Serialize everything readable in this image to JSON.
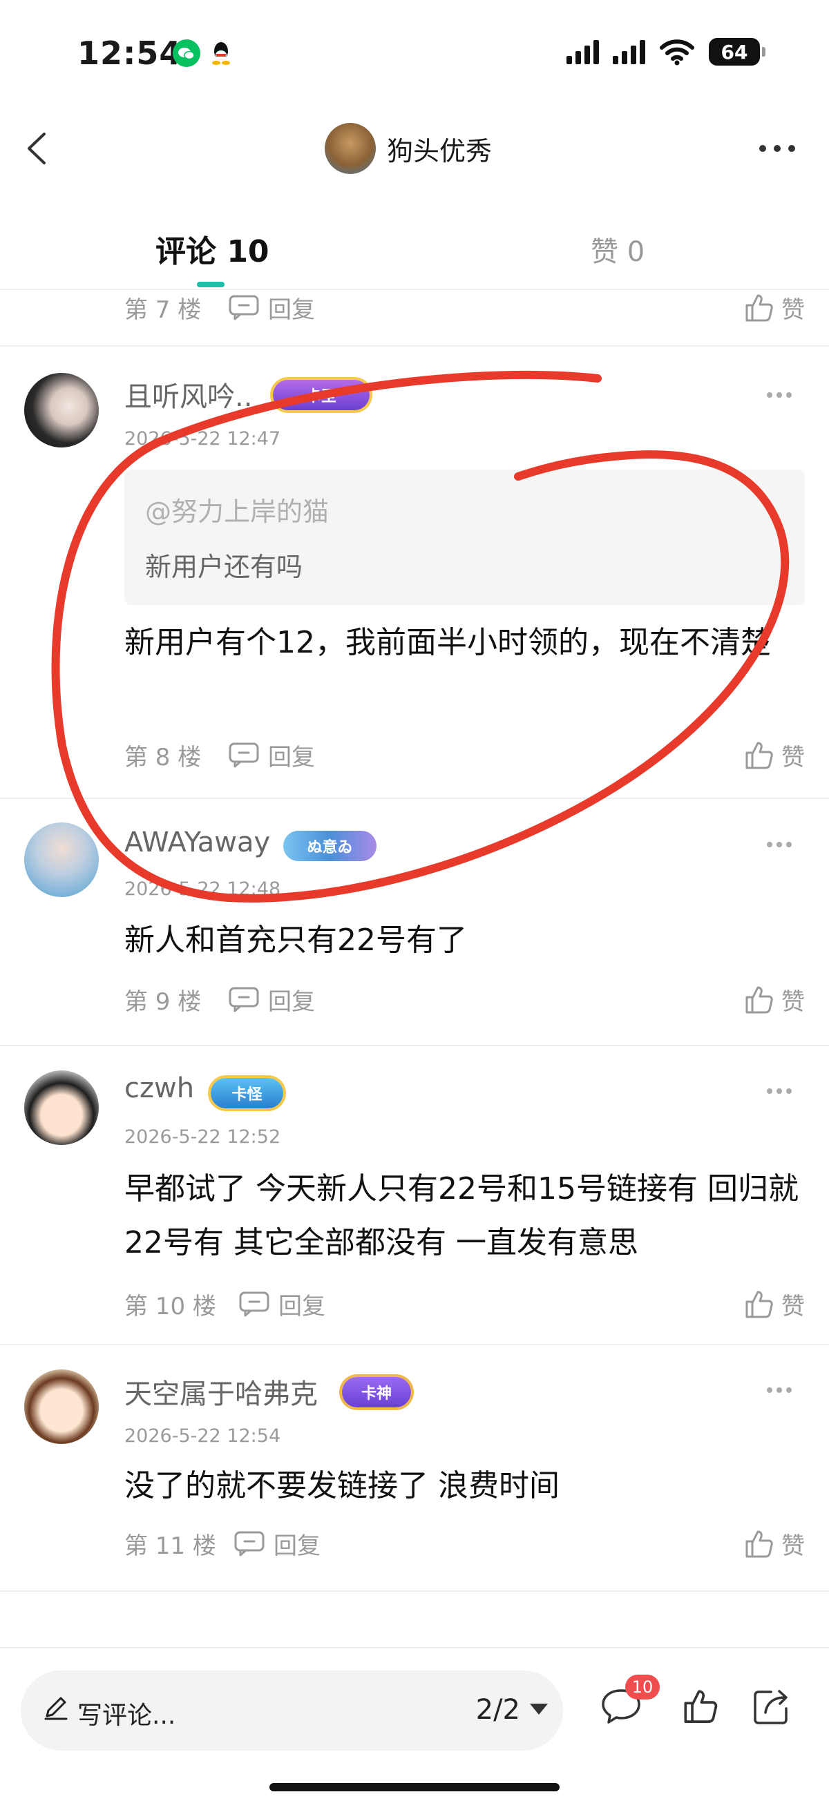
{
  "status_bar": {
    "time": "12:54",
    "battery": "64"
  },
  "nav": {
    "title": "狗头优秀"
  },
  "tabs": {
    "comments": "评论 10",
    "likes": "赞 0"
  },
  "labels": {
    "reply": "回复",
    "like": "赞"
  },
  "partial_row": {
    "floor": "第 7 楼"
  },
  "comments": [
    {
      "username": "且听风吟..",
      "badge": "卡圣",
      "timestamp": "2026-5-22 12:47",
      "quote_user": "@努力上岸的猫",
      "quote_text": "新用户还有吗",
      "text": "新用户有个12，我前面半小时领的，现在不清楚",
      "floor": "第 8 楼"
    },
    {
      "username": "AWAYaway",
      "badge": "ぬ意ゐ",
      "timestamp": "2026-5-22 12:48",
      "text": "新人和首充只有22号有了",
      "floor": "第 9 楼"
    },
    {
      "username": "czwh",
      "badge": "卡怪",
      "timestamp": "2026-5-22 12:52",
      "text": "早都试了 今天新人只有22号和15号链接有 回归就22号有 其它全部都没有 一直发有意思",
      "floor": "第 10 楼"
    },
    {
      "username": "天空属于哈弗克",
      "badge": "卡神",
      "timestamp": "2026-5-22 12:54",
      "text": "没了的就不要发链接了  浪费时间",
      "floor": "第 11 楼"
    }
  ],
  "bottom_bar": {
    "input_label": "写评论...",
    "page": "2/2",
    "comment_count": "10"
  },
  "colors": {
    "accent": "#1dbfa8",
    "annotation": "#e83a2b",
    "badge_red": "#f04e4e"
  }
}
